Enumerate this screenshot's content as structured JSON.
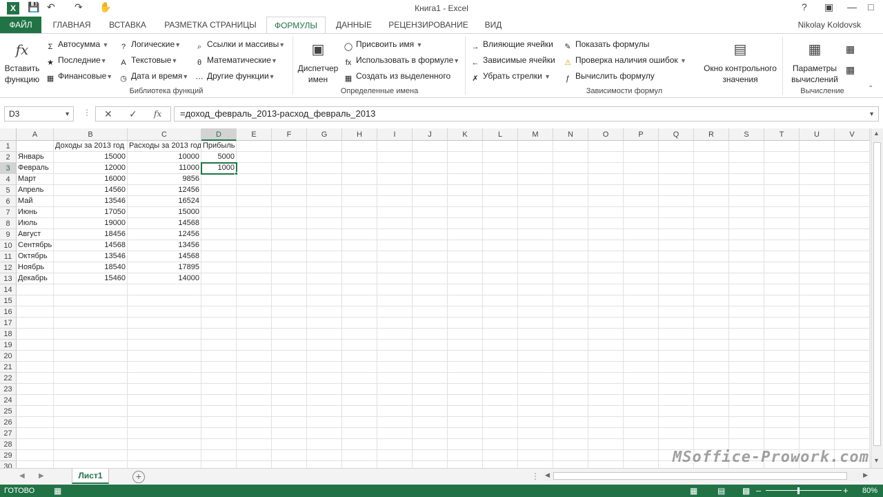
{
  "window": {
    "title": "Книга1 - Excel",
    "user": "Nikolay Koldovsk"
  },
  "ribbon_tabs": [
    "ФАЙЛ",
    "ГЛАВНАЯ",
    "ВСТАВКА",
    "РАЗМЕТКА СТРАНИЦЫ",
    "ФОРМУЛЫ",
    "ДАННЫЕ",
    "РЕЦЕНЗИРОВАНИЕ",
    "ВИД"
  ],
  "active_tab": "ФОРМУЛЫ",
  "ribbon": {
    "function_library": {
      "insert_function": "Вставить функцию",
      "autosum": "Автосумма",
      "recent": "Последние",
      "financial": "Финансовые",
      "logical": "Логические",
      "text": "Текстовые",
      "datetime": "Дата и время",
      "lookup": "Ссылки и массивы",
      "math": "Математические",
      "other": "Другие функции",
      "label": "Библиотека функций"
    },
    "defined_names": {
      "name_manager": "Диспетчер имен",
      "define_name": "Присвоить имя",
      "use_in_formula": "Использовать в формуле",
      "create_from_selection": "Создать из выделенного",
      "label": "Определенные имена"
    },
    "formula_auditing": {
      "trace_precedents": "Влияющие ячейки",
      "trace_dependents": "Зависимые ячейки",
      "remove_arrows": "Убрать стрелки",
      "show_formulas": "Показать формулы",
      "error_checking": "Проверка наличия ошибок",
      "evaluate_formula": "Вычислить формулу",
      "watch_window": "Окно контрольного значения",
      "label": "Зависимости формул"
    },
    "calculation": {
      "calc_options": "Параметры вычислений",
      "label": "Вычисление"
    }
  },
  "formula_bar": {
    "name_box": "D3",
    "formula": "=доход_февраль_2013-расход_февраль_2013"
  },
  "sheet": {
    "columns": [
      "A",
      "B",
      "C",
      "D",
      "E",
      "F",
      "G",
      "H",
      "I",
      "J",
      "K",
      "L",
      "M",
      "N",
      "O",
      "P",
      "Q",
      "R",
      "S",
      "T",
      "U",
      "V"
    ],
    "row_count": 30,
    "header_row": [
      "",
      "Доходы за 2013 год",
      "Расходы за 2013 год",
      "Прибыль"
    ],
    "data": [
      [
        "Январь",
        "15000",
        "10000",
        "5000"
      ],
      [
        "Февраль",
        "12000",
        "11000",
        "1000"
      ],
      [
        "Март",
        "16000",
        "9856",
        ""
      ],
      [
        "Апрель",
        "14560",
        "12456",
        ""
      ],
      [
        "Май",
        "13546",
        "16524",
        ""
      ],
      [
        "Июнь",
        "17050",
        "15000",
        ""
      ],
      [
        "Июль",
        "19000",
        "14568",
        ""
      ],
      [
        "Август",
        "18456",
        "12456",
        ""
      ],
      [
        "Сентябрь",
        "14568",
        "13456",
        ""
      ],
      [
        "Октябрь",
        "13546",
        "14568",
        ""
      ],
      [
        "Ноябрь",
        "18540",
        "17895",
        ""
      ],
      [
        "Декабрь",
        "15460",
        "14000",
        ""
      ]
    ],
    "selected_cell": "D3"
  },
  "sheet_tab": "Лист1",
  "status": {
    "ready": "ГОТОВО",
    "zoom": "80%"
  },
  "watermark": "MSoffice-Prowork.com"
}
